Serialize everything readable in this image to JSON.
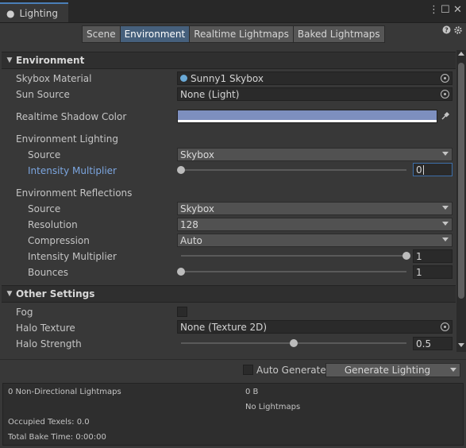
{
  "window": {
    "tab_label": "Lighting"
  },
  "modes": [
    {
      "label": "Scene",
      "selected": false
    },
    {
      "label": "Environment",
      "selected": true
    },
    {
      "label": "Realtime Lightmaps",
      "selected": false
    },
    {
      "label": "Baked Lightmaps",
      "selected": false
    }
  ],
  "environment": {
    "header": "Environment",
    "skybox_label": "Skybox Material",
    "skybox_value": "Sunny1 Skybox",
    "sun_label": "Sun Source",
    "sun_value": "None (Light)",
    "shadow_label": "Realtime Shadow Color",
    "shadow_color": "#7d8fbf",
    "lighting_group": "Environment Lighting",
    "lighting_source_label": "Source",
    "lighting_source_value": "Skybox",
    "intensity_label": "Intensity Multiplier",
    "intensity_value": "0",
    "intensity_fraction": 0,
    "reflections_group": "Environment Reflections",
    "refl_source_label": "Source",
    "refl_source_value": "Skybox",
    "resolution_label": "Resolution",
    "resolution_value": "128",
    "compression_label": "Compression",
    "compression_value": "Auto",
    "refl_intensity_label": "Intensity Multiplier",
    "refl_intensity_value": "1",
    "refl_intensity_fraction": 1,
    "bounces_label": "Bounces",
    "bounces_value": "1",
    "bounces_fraction": 0
  },
  "other": {
    "header": "Other Settings",
    "fog_label": "Fog",
    "fog_checked": false,
    "halo_texture_label": "Halo Texture",
    "halo_texture_value": "None (Texture 2D)",
    "halo_strength_label": "Halo Strength",
    "halo_strength_value": "0.5",
    "halo_strength_fraction": 0.5
  },
  "bottom": {
    "auto_generate_label": "Auto Generate",
    "auto_generate_checked": false,
    "generate_label": "Generate Lighting"
  },
  "stats": {
    "lightmaps": "0 Non-Directional Lightmaps",
    "size": "0 B",
    "no_lightmaps": "No Lightmaps",
    "texels": "Occupied Texels: 0.0",
    "bake_time": "Total Bake Time: 0:00:00"
  }
}
